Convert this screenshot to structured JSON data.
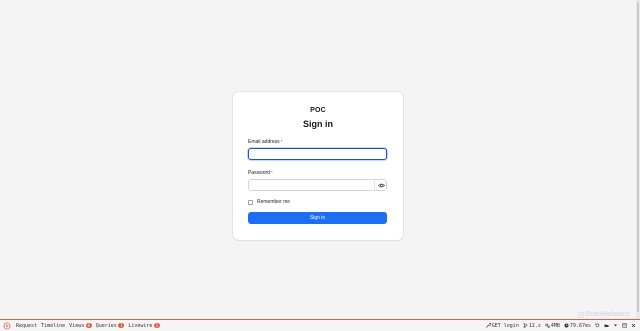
{
  "login": {
    "brand": "POC",
    "heading": "Sign in",
    "email_label": "Email address",
    "email_value": "",
    "password_label": "Password",
    "password_value": "",
    "required_mark": "*",
    "remember_label": "Remember me",
    "remember_checked": false,
    "submit_label": "Sign in"
  },
  "watermark": {
    "text": "ScanMalware"
  },
  "debugbar": {
    "tabs": [
      {
        "label": "Request",
        "badge": ""
      },
      {
        "label": "Timeline",
        "badge": ""
      },
      {
        "label": "Views",
        "badge": "9"
      },
      {
        "label": "Queries",
        "badge": "1"
      },
      {
        "label": "Livewire",
        "badge": "1"
      }
    ],
    "route": "GET login",
    "duration": "12.s",
    "memory": "4MB",
    "time": "79.67ms",
    "accent_color": "#e25b43"
  },
  "colors": {
    "primary": "#1d6ef5",
    "focus": "#1d4ed8",
    "background": "#f4f4f5"
  }
}
